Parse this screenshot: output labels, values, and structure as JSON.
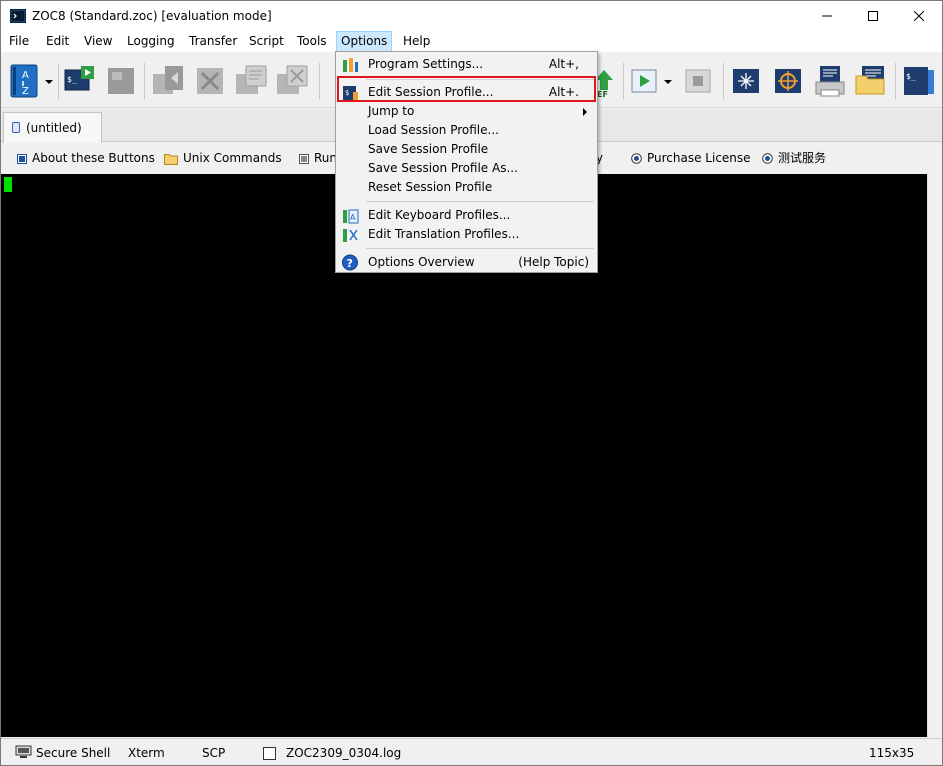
{
  "window": {
    "title": "ZOC8 (Standard.zoc) [evaluation mode]"
  },
  "menubar": {
    "items": [
      {
        "label": "File"
      },
      {
        "label": "Edit"
      },
      {
        "label": "View"
      },
      {
        "label": "Logging"
      },
      {
        "label": "Transfer"
      },
      {
        "label": "Script"
      },
      {
        "label": "Tools"
      },
      {
        "label": "Options"
      },
      {
        "label": "Help"
      }
    ]
  },
  "tabs": [
    {
      "label": "(untitled)"
    }
  ],
  "buttonbar": {
    "items": [
      {
        "label": "About these Buttons",
        "icon": "square-icon"
      },
      {
        "label": "Unix Commands",
        "icon": "folder-icon"
      },
      {
        "label": "Run",
        "icon": "square-icon"
      },
      {
        "label": "ry",
        "icon": ""
      },
      {
        "label": "Purchase License",
        "icon": "radio-icon"
      },
      {
        "label": "测试服务",
        "icon": "radio-icon"
      }
    ]
  },
  "statusbar": {
    "protocol": "Secure Shell",
    "emulation": "Xterm",
    "transfer": "SCP",
    "logfile": "ZOC2309_0304.log",
    "size": "115x35"
  },
  "options_menu": {
    "items": [
      {
        "label": "Program Settings...",
        "accel": "Alt+,",
        "icon": "program-settings-icon"
      },
      {
        "label": "Edit Session Profile...",
        "accel": "Alt+.",
        "icon": "session-profile-icon"
      },
      {
        "label": "Jump to",
        "accel": "",
        "icon": ""
      },
      {
        "label": "Load Session Profile...",
        "accel": "",
        "icon": ""
      },
      {
        "label": "Save Session Profile",
        "accel": "",
        "icon": ""
      },
      {
        "label": "Save Session Profile As...",
        "accel": "",
        "icon": ""
      },
      {
        "label": "Reset Session Profile",
        "accel": "",
        "icon": ""
      },
      {
        "label": "Edit Keyboard Profiles...",
        "accel": "",
        "icon": "keyboard-profile-icon"
      },
      {
        "label": "Edit Translation Profiles...",
        "accel": "",
        "icon": "translation-profile-icon"
      },
      {
        "label": "Options Overview",
        "accel": "(Help Topic)",
        "icon": "help-icon"
      }
    ]
  },
  "colors": {
    "terminal_bg": "#000000",
    "cursor": "#00e000",
    "highlight": "#e0161c",
    "menu_active": "#cce8ff"
  }
}
